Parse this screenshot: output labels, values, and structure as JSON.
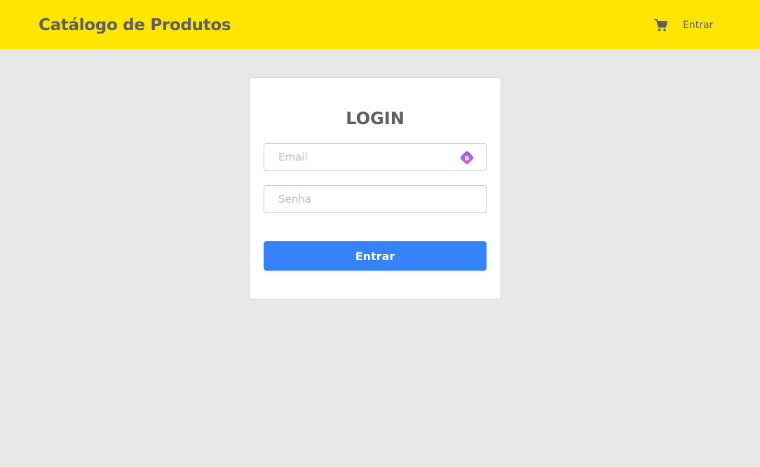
{
  "navbar": {
    "brand": "Catálogo de Produtos",
    "cart_icon": "shopping-cart-icon",
    "login_link": "Entrar",
    "background_color": "#ffe600",
    "text_color": "#5f5f5f"
  },
  "login_card": {
    "title": "LOGIN",
    "email": {
      "placeholder": "Email",
      "value": ""
    },
    "password": {
      "placeholder": "Senha",
      "value": ""
    },
    "autofill_badge": {
      "icon": "password-manager-icon",
      "label": "8"
    },
    "submit_label": "Entrar",
    "button_color": "#3483fa"
  },
  "page": {
    "background_color": "#e8e8e8"
  }
}
